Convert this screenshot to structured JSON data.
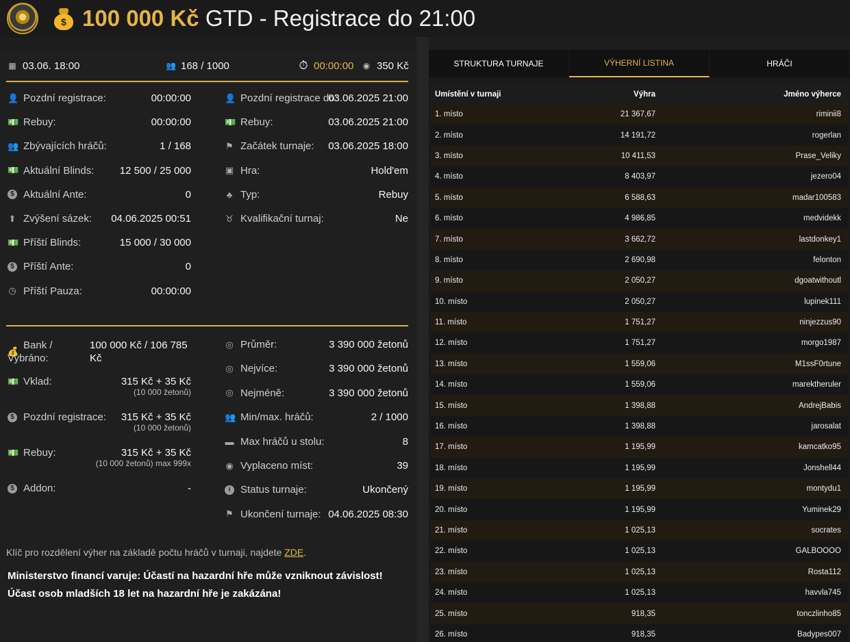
{
  "header": {
    "title_amount": "100 000 Kč",
    "title_rest": "GTD - Registrace do 21:00"
  },
  "topbar": {
    "date": "03.06. 18:00",
    "players": "168 / 1000",
    "timer": "00:00:00",
    "buyin": "350 Kč"
  },
  "info_left": [
    {
      "label": "Pozdní registrace:",
      "value": "00:00:00",
      "icon": "user-icon"
    },
    {
      "label": "Rebuy:",
      "value": "00:00:00",
      "icon": "money-icon"
    },
    {
      "label": "Zbývajících hráčů:",
      "value": "1 / 168",
      "icon": "users-icon"
    },
    {
      "label": "Aktuální Blinds:",
      "value": "12 500 / 25 000",
      "icon": "money-icon"
    },
    {
      "label": "Aktuální Ante:",
      "value": "0",
      "icon": "coin-icon"
    },
    {
      "label": "Zvýšení sázek:",
      "value": "04.06.2025 00:51",
      "icon": "arrow-up-icon"
    },
    {
      "label": "Příští Blinds:",
      "value": "15 000 / 30 000",
      "icon": "money-icon"
    },
    {
      "label": "Příští Ante:",
      "value": "0",
      "icon": "coin-icon"
    },
    {
      "label": "Příští Pauza:",
      "value": "00:00:00",
      "icon": "clock-icon"
    }
  ],
  "info_right": [
    {
      "label": "Pozdní registrace do:",
      "value": "03.06.2025 21:00",
      "icon": "user-icon"
    },
    {
      "label": "Rebuy:",
      "value": "03.06.2025 21:00",
      "icon": "money-icon"
    },
    {
      "label": "Začátek turnaje:",
      "value": "03.06.2025 18:00",
      "icon": "flag-icon"
    },
    {
      "label": "Hra:",
      "value": "Hold'em",
      "icon": "cards-icon"
    },
    {
      "label": "Typ:",
      "value": "Rebuy",
      "icon": "clover-icon"
    },
    {
      "label": "Kvalifikační turnaj:",
      "value": "Ne",
      "icon": "medal-icon"
    }
  ],
  "money_left": [
    {
      "label": "Bank /",
      "label2": "Vybráno:",
      "value": "100 000 Kč / 106 785",
      "value2": "Kč",
      "icon": "bag-icon"
    },
    {
      "label": "Vklad:",
      "value": "315 Kč + 35 Kč",
      "sub": "(10 000 žetonů)",
      "icon": "money-icon"
    },
    {
      "label": "Pozdní registrace:",
      "value": "315 Kč + 35 Kč",
      "sub": "(10 000 žetonů)",
      "icon": "coin-icon"
    },
    {
      "label": "Rebuy:",
      "value": "315 Kč + 35 Kč",
      "sub": "(10 000 žetonů) max 999x",
      "icon": "money-icon"
    },
    {
      "label": "Addon:",
      "value": "-",
      "icon": "coin-icon"
    }
  ],
  "money_right": [
    {
      "label": "Průměr:",
      "value": "3 390 000 žetonů",
      "icon": "chip-icon"
    },
    {
      "label": "Nejvíce:",
      "value": "3 390 000 žetonů",
      "icon": "chip-icon"
    },
    {
      "label": "Nejméně:",
      "value": "3 390 000 žetonů",
      "icon": "chip-icon"
    },
    {
      "label": "Min/max. hráčů:",
      "value": "2 / 1000",
      "icon": "users-icon"
    },
    {
      "label": "Max hráčů u stolu:",
      "value": "8",
      "icon": "table-icon"
    },
    {
      "label": "Vyplaceno míst:",
      "value": "39",
      "icon": "payout-icon"
    },
    {
      "label": "Status turnaje:",
      "value": "Ukončený",
      "icon": "info-icon"
    },
    {
      "label": "Ukončení turnaje:",
      "value": "04.06.2025 08:30",
      "icon": "flag-icon"
    }
  ],
  "note": {
    "text": "Klíč pro rozdělení výher na základě počtu hráčů v turnaji, najdete",
    "link": "ZDE",
    "end": "."
  },
  "warning": {
    "line1": "Ministerstvo financí varuje: Účastí na hazardní hře může vzniknout závislost!",
    "line2": "Účast osob mladších 18 let na hazardní hře je zakázána!"
  },
  "tabs": [
    "STRUKTURA TURNAJE",
    "VÝHERNÍ LISTINA",
    "HRÁČI"
  ],
  "table": {
    "headers": [
      "Umístění v turnaji",
      "Výhra",
      "Jméno výherce"
    ],
    "rows": [
      [
        "1. místo",
        "21 367,67",
        "riminii8"
      ],
      [
        "2. místo",
        "14 191,72",
        "rogerlan"
      ],
      [
        "3. místo",
        "10 411,53",
        "Prase_Veliky"
      ],
      [
        "4. místo",
        "8 403,97",
        "jezero04"
      ],
      [
        "5. místo",
        "6 588,63",
        "madar100583"
      ],
      [
        "6. místo",
        "4 986,85",
        "medvidekk"
      ],
      [
        "7. místo",
        "3 662,72",
        "lastdonkey1"
      ],
      [
        "8. místo",
        "2 690,98",
        "felonton"
      ],
      [
        "9. místo",
        "2 050,27",
        "dgoatwithoutl"
      ],
      [
        "10. místo",
        "2 050,27",
        "lupinek111"
      ],
      [
        "11. místo",
        "1 751,27",
        "ninjezzus90"
      ],
      [
        "12. místo",
        "1 751,27",
        "morgo1987"
      ],
      [
        "13. místo",
        "1 559,06",
        "M1ssF0rtune"
      ],
      [
        "14. místo",
        "1 559,06",
        "marektheruler"
      ],
      [
        "15. místo",
        "1 398,88",
        "AndrejBabis"
      ],
      [
        "16. místo",
        "1 398,88",
        "jarosalat"
      ],
      [
        "17. místo",
        "1 195,99",
        "kamcatko95"
      ],
      [
        "18. místo",
        "1 195,99",
        "Jonshell44"
      ],
      [
        "19. místo",
        "1 195,99",
        "montydu1"
      ],
      [
        "20. místo",
        "1 195,99",
        "Yuminek29"
      ],
      [
        "21. místo",
        "1 025,13",
        "socrates"
      ],
      [
        "22. místo",
        "1 025,13",
        "GALBOOOO"
      ],
      [
        "23. místo",
        "1 025,13",
        "Rosta112"
      ],
      [
        "24. místo",
        "1 025,13",
        "havvla745"
      ],
      [
        "25. místo",
        "918,35",
        "tonczlinho85"
      ],
      [
        "26. místo",
        "918,35",
        "Badypes007"
      ]
    ]
  }
}
